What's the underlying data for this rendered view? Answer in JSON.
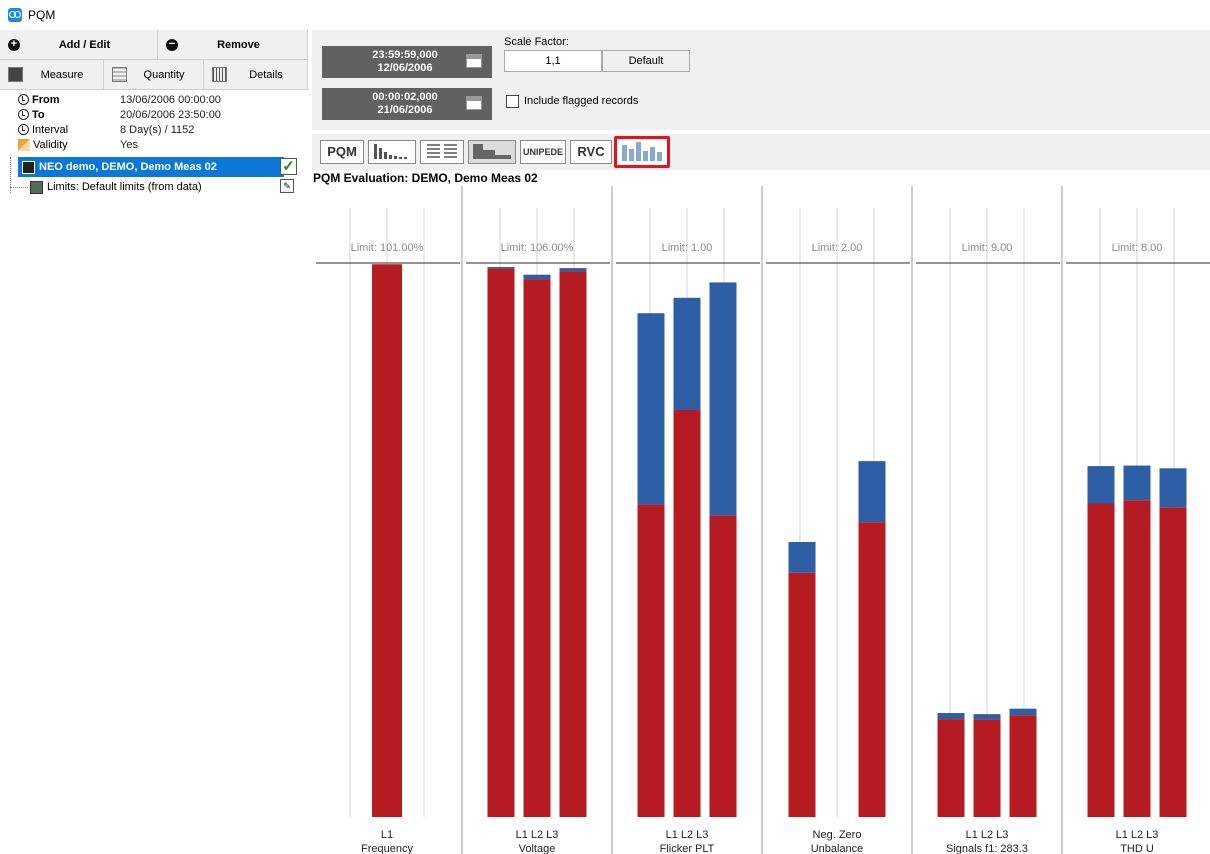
{
  "window": {
    "title": "PQM"
  },
  "left": {
    "add_edit": "Add / Edit",
    "remove": "Remove",
    "tabs": [
      "Measure",
      "Quantity",
      "Details"
    ],
    "props": [
      {
        "key": "From",
        "value": "13/06/2006 00:00:00"
      },
      {
        "key": "To",
        "value": "20/06/2006 23:50:00"
      },
      {
        "key": "Interval",
        "value": "8 Day(s) / 1152"
      },
      {
        "key": "Validity",
        "value": "Yes"
      }
    ],
    "tree": {
      "selected": "NEO demo, DEMO, Demo Meas 02",
      "limits": "Limits: Default limits (from data)"
    }
  },
  "toolbar": {
    "start": {
      "time": "23:59:59,000",
      "date": "12/06/2006"
    },
    "end": {
      "time": "00:00:02,000",
      "date": "21/06/2006"
    },
    "scale_label": "Scale Factor:",
    "scale_value": "1,1",
    "default_btn": "Default",
    "include_flagged": "Include flagged records"
  },
  "views": [
    {
      "name": "pqm",
      "label": "PQM"
    },
    {
      "name": "histogram",
      "label": ""
    },
    {
      "name": "table",
      "label": ""
    },
    {
      "name": "duration",
      "label": ""
    },
    {
      "name": "unipede",
      "label": "UNIPEDE"
    },
    {
      "name": "rvc",
      "label": "RVC"
    },
    {
      "name": "bars",
      "label": ""
    }
  ],
  "chart_title": "PQM Evaluation: DEMO, Demo Meas 02",
  "colors": {
    "red": "#b51c22",
    "blue": "#2e5ea3",
    "selection": "#0b78d7",
    "highlight": "#e3141b"
  },
  "chart_data": {
    "type": "bar",
    "stacked": true,
    "scale": "percent of limit",
    "ylim": [
      0,
      120
    ],
    "series": [
      {
        "name": "",
        "color": "#b51c22"
      },
      {
        "name": "",
        "color": "#2e5ea3"
      }
    ],
    "groups": [
      {
        "name": "Frequency",
        "limit": "Limit: 101.00%",
        "labels": [
          "L1"
        ],
        "red": [
          100.5
        ],
        "total": [
          100.5
        ]
      },
      {
        "name": "Voltage",
        "limit": "Limit: 106.00%",
        "labels": [
          "L1",
          "L2",
          "L3"
        ],
        "red": [
          99.7,
          97.8,
          99.2
        ],
        "total": [
          100.0,
          98.6,
          99.8
        ]
      },
      {
        "name": "Flicker PLT",
        "limit": "Limit: 1.00",
        "labels": [
          "L1",
          "L2",
          "L3"
        ],
        "red": [
          56.8,
          74.0,
          54.8
        ],
        "total": [
          91.6,
          94.4,
          97.2
        ]
      },
      {
        "name": "Unbalance",
        "limit": "Limit: 2.00",
        "labels": [
          "Neg.",
          "Zero"
        ],
        "red": [
          44.4,
          53.6
        ],
        "total": [
          50.0,
          64.7
        ]
      },
      {
        "name": "Signals f1: 283.3",
        "limit": "Limit: 9.00",
        "labels": [
          "L1",
          "L2",
          "L3"
        ],
        "red": [
          17.8,
          17.7,
          18.5
        ],
        "total": [
          18.9,
          18.7,
          19.7
        ]
      },
      {
        "name": "THD U",
        "limit": "Limit: 8.00",
        "labels": [
          "L1",
          "L2",
          "L3"
        ],
        "red": [
          57.0,
          57.6,
          56.3
        ],
        "total": [
          63.8,
          63.9,
          63.4
        ]
      }
    ]
  }
}
